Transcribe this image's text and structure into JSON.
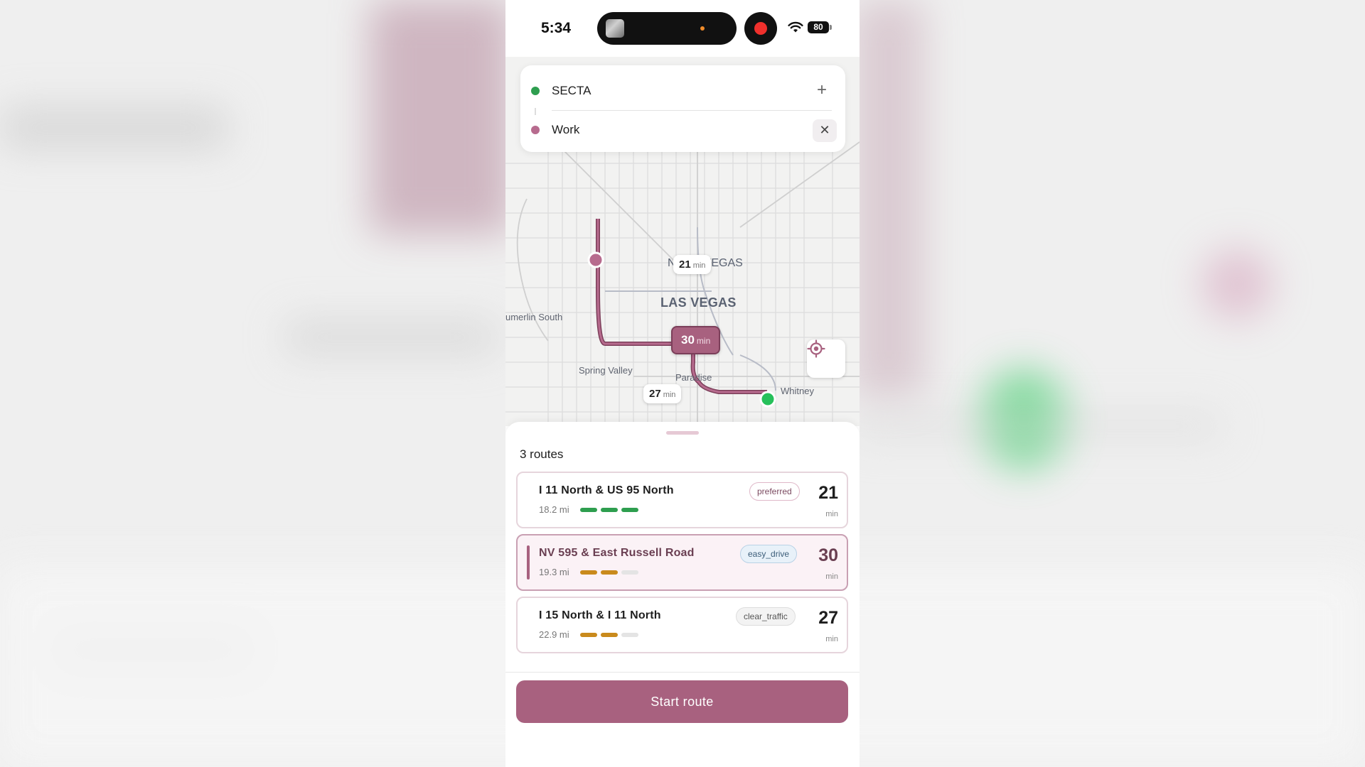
{
  "status_bar": {
    "time": "5:34",
    "battery": "80"
  },
  "search": {
    "origin": "SECTA",
    "destination": "Work",
    "add_stop_icon": "+",
    "clear_icon": "✕"
  },
  "map": {
    "labels": {
      "north_las_vegas": "N LAS VEGAS",
      "las_vegas": "LAS VEGAS",
      "summerlin_south": "umerlin South",
      "spring_valley": "Spring Valley",
      "paradise": "Paradise",
      "whitney": "Whitney"
    },
    "chips": [
      {
        "minutes": "21",
        "unit": "min"
      },
      {
        "minutes": "30",
        "unit": "min"
      },
      {
        "minutes": "27",
        "unit": "min"
      }
    ],
    "colors": {
      "origin": "#2e9e4f",
      "destination": "#b76b8e",
      "route": "#a8617f"
    }
  },
  "routes": {
    "count_label": "3 routes",
    "items": [
      {
        "name": "I 11 North & US 95 North",
        "distance": "18.2 mi",
        "tag": "preferred",
        "minutes": "21",
        "unit": "min",
        "traffic": [
          "green",
          "green",
          "green"
        ]
      },
      {
        "name": "NV 595 & East Russell Road",
        "distance": "19.3 mi",
        "tag": "easy_drive",
        "minutes": "30",
        "unit": "min",
        "traffic": [
          "amber",
          "amber",
          "empty"
        ]
      },
      {
        "name": "I 15 North & I 11 North",
        "distance": "22.9 mi",
        "tag": "clear_traffic",
        "minutes": "27",
        "unit": "min",
        "traffic": [
          "amber",
          "amber",
          "empty"
        ]
      }
    ]
  },
  "actions": {
    "start_route": "Start route"
  }
}
